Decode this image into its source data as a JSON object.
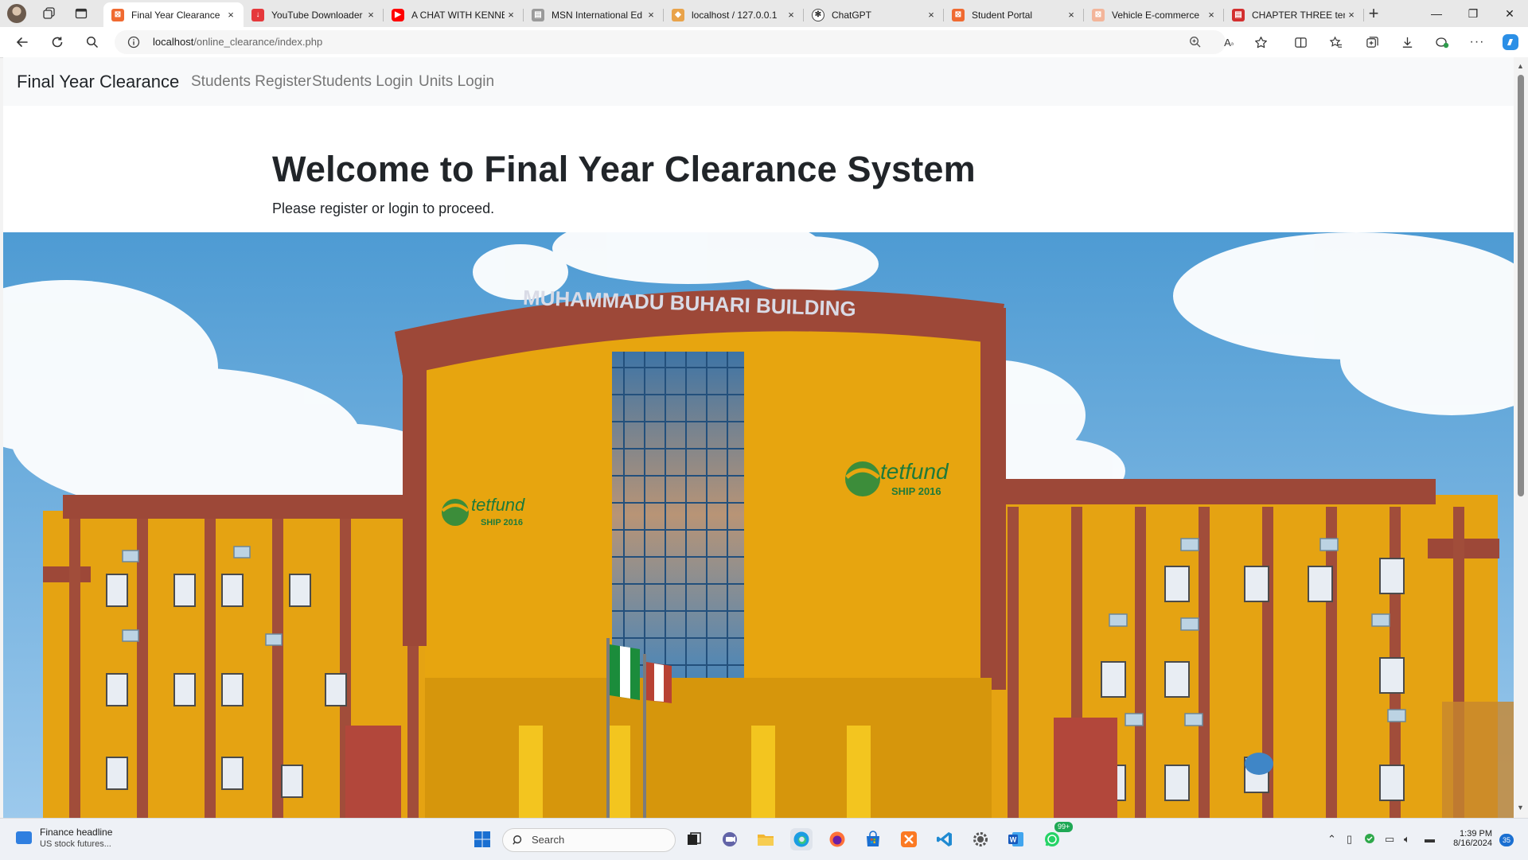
{
  "browser": {
    "tabs": [
      {
        "title": "Final Year Clearance",
        "favicon": "xampp-icon",
        "active": true
      },
      {
        "title": "YouTube Downloader",
        "favicon": "download-icon",
        "active": false
      },
      {
        "title": "A CHAT WITH KENNETH",
        "favicon": "youtube-icon",
        "active": false
      },
      {
        "title": "MSN International Ed",
        "favicon": "document-icon",
        "active": false
      },
      {
        "title": "localhost / 127.0.0.1",
        "favicon": "phpmyadmin-icon",
        "active": false
      },
      {
        "title": "ChatGPT",
        "favicon": "chatgpt-icon",
        "active": false
      },
      {
        "title": "Student Portal",
        "favicon": "xampp-icon",
        "active": false
      },
      {
        "title": "Vehicle E-commerce",
        "favicon": "xampp-icon",
        "active": false
      },
      {
        "title": "CHAPTER THREE ten",
        "favicon": "pdf-icon",
        "active": false
      }
    ],
    "close_glyph": "×",
    "new_tab_glyph": "+",
    "url_host": "localhost",
    "url_path": "/online_clearance/index.php"
  },
  "page": {
    "navbar": {
      "brand": "Final Year Clearance",
      "links": [
        "Students Register",
        "Students Login",
        "Units Login"
      ]
    },
    "heading": "Welcome to Final Year Clearance System",
    "subheading": "Please register or login to proceed.",
    "hero_image": {
      "building_sign": "MUHAMMADU BUHARI BUILDING",
      "logo_text": "tetfund",
      "logo_subtext": "SHIP 2016"
    }
  },
  "taskbar": {
    "news_title": "Finance headline",
    "news_sub": "US stock futures...",
    "search_placeholder": "Search",
    "time": "1:39 PM",
    "date": "8/16/2024",
    "whatsapp_badge": "99+",
    "notifications": "35"
  },
  "colors": {
    "building": "#e7a50f",
    "roof": "#9f4a3a",
    "sky": "#5fa6d9",
    "accent_edge": "#1a6fd1"
  }
}
